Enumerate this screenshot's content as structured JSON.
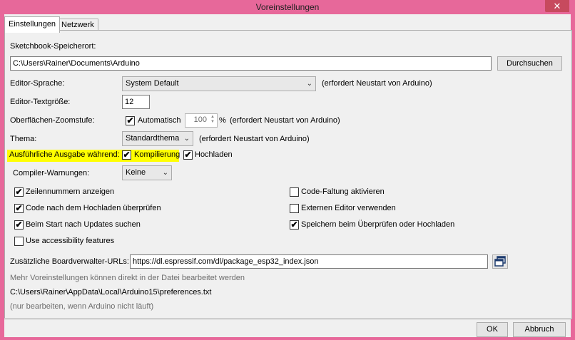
{
  "window": {
    "title": "Voreinstellungen",
    "close_glyph": "✕"
  },
  "tabs": [
    {
      "label": "Einstellungen",
      "active": true
    },
    {
      "label": "Netzwerk",
      "active": false
    }
  ],
  "sketchbook": {
    "label": "Sketchbook-Speicherort:",
    "value": "C:\\Users\\Rainer\\Documents\\Arduino",
    "browse_label": "Durchsuchen"
  },
  "editor_language": {
    "label": "Editor-Sprache:",
    "value": "System Default",
    "note": "(erfordert Neustart von Arduino)"
  },
  "editor_fontsize": {
    "label": "Editor-Textgröße:",
    "value": "12"
  },
  "zoom": {
    "label": "Oberflächen-Zoomstufe:",
    "auto_label": "Automatisch",
    "auto_checked": true,
    "value": "100",
    "unit": "%",
    "note": "(erfordert Neustart von Arduino)"
  },
  "theme": {
    "label": "Thema:",
    "value": "Standardthema",
    "note": "(erfordert Neustart von Arduino)"
  },
  "verbose": {
    "label": "Ausführliche Ausgabe während:",
    "compile_label": "Kompilierung",
    "compile_checked": true,
    "upload_label": "Hochladen",
    "upload_checked": true,
    "highlight_color": "#ffff00"
  },
  "compiler_warnings": {
    "label": "Compiler-Warnungen:",
    "value": "Keine"
  },
  "options_left": [
    {
      "label": "Zeilennummern anzeigen",
      "checked": true
    },
    {
      "label": "Code nach dem Hochladen überprüfen",
      "checked": true
    },
    {
      "label": "Beim Start nach Updates suchen",
      "checked": true
    },
    {
      "label": "Use accessibility features",
      "checked": false
    }
  ],
  "options_right": [
    {
      "label": "Code-Faltung aktivieren",
      "checked": false
    },
    {
      "label": "Externen Editor verwenden",
      "checked": false
    },
    {
      "label": "Speichern beim Überprüfen oder Hochladen",
      "checked": true
    }
  ],
  "boards_manager": {
    "label": "Zusätzliche Boardverwalter-URLs:",
    "value": "https://dl.espressif.com/dl/package_esp32_index.json"
  },
  "info": {
    "more_prefs": "Mehr Voreinstellungen können direkt in der Datei bearbeitet werden",
    "path": "C:\\Users\\Rainer\\AppData\\Local\\Arduino15\\preferences.txt",
    "note": "(nur bearbeiten, wenn Arduino nicht läuft)"
  },
  "footer": {
    "ok_label": "OK",
    "cancel_label": "Abbruch"
  },
  "colors": {
    "titlebar": "#e7689a",
    "close_button": "#c74a5e"
  },
  "icons": {
    "check": "✔",
    "chevron": "⌄"
  }
}
